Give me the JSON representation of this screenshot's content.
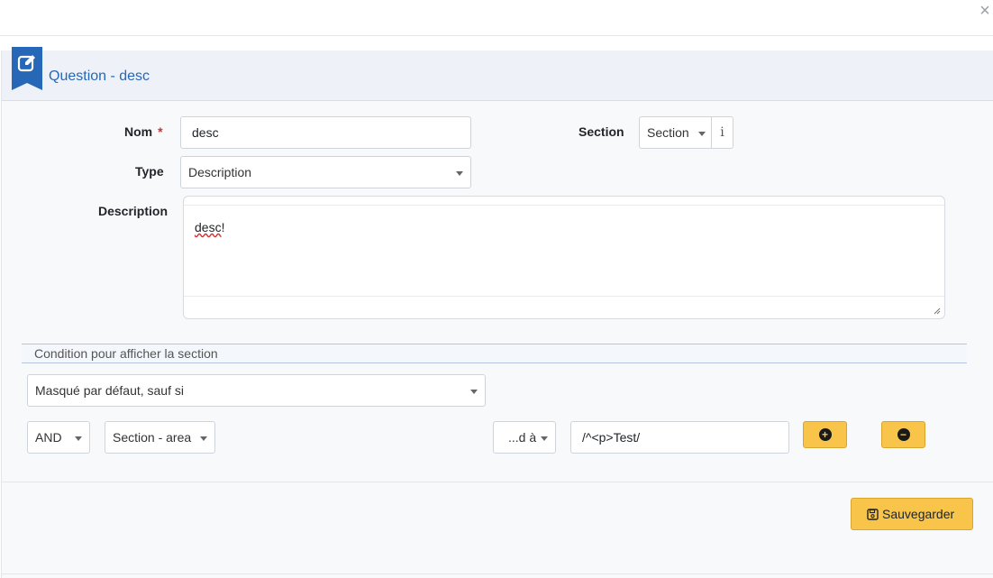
{
  "header": {
    "title": "Question - desc"
  },
  "close": {
    "glyph": "×"
  },
  "form": {
    "name_label": "Nom",
    "required_mark": "*",
    "name_value": "desc",
    "type_label": "Type",
    "type_value": "Description",
    "description_label": "Description",
    "description_value_word": "desc",
    "description_value_punct": "!",
    "section_label": "Section",
    "section_value": "Section",
    "section_info": "i"
  },
  "condition": {
    "heading": "Condition pour afficher la section",
    "mode_value": "Masqué par défaut, sauf si",
    "logic_value": "AND",
    "field_value": "Section - area",
    "operator_value": "...d à",
    "match_value": "/^<p>Test/",
    "add_glyph": "+",
    "remove_glyph": "−"
  },
  "footer": {
    "save_label": "Sauvegarder"
  },
  "colors": {
    "accent": "#2667b8",
    "button": "#f8c54a",
    "required": "#d32f2f"
  }
}
